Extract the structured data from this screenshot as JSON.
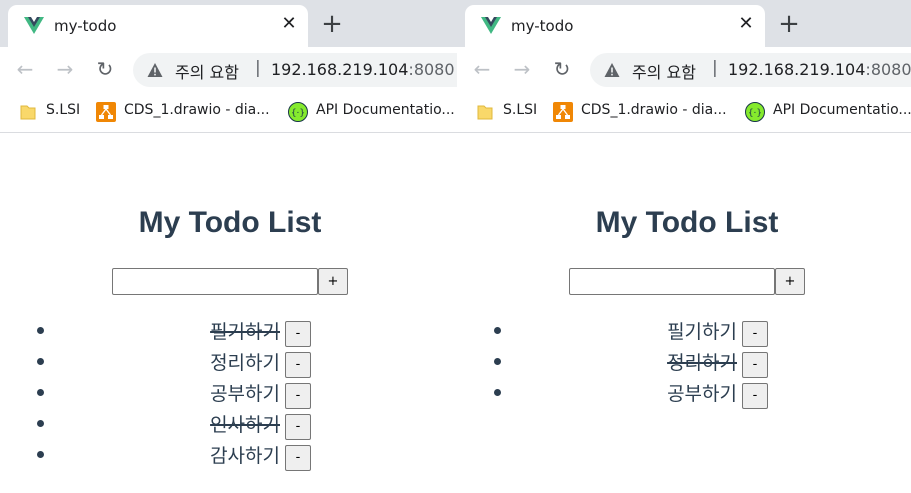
{
  "browser_left": {
    "tab_title": "my-todo",
    "omnibox": {
      "warning": "주의 요함",
      "separator": "|",
      "host": "192.168.219.104",
      "port": ":8080"
    },
    "bookmarks": [
      {
        "label": "S.LSI",
        "icon": "folder-icon"
      },
      {
        "label": "CDS_1.drawio - dia...",
        "icon": "drawio-icon"
      },
      {
        "label": "API Documentatio...",
        "icon": "swagger-icon"
      }
    ],
    "page": {
      "title": "My Todo List",
      "add_label": "+",
      "input_value": "",
      "items": [
        {
          "text": "필기하기",
          "done": true,
          "delete_label": "-"
        },
        {
          "text": "정리하기",
          "done": false,
          "delete_label": "-"
        },
        {
          "text": "공부하기",
          "done": false,
          "delete_label": "-"
        },
        {
          "text": "인사하기",
          "done": true,
          "delete_label": "-"
        },
        {
          "text": "감사하기",
          "done": false,
          "delete_label": "-"
        }
      ]
    }
  },
  "browser_right": {
    "tab_title": "my-todo",
    "omnibox": {
      "warning": "주의 요함",
      "separator": "|",
      "host": "192.168.219.104",
      "port": ":8080"
    },
    "bookmarks": [
      {
        "label": "S.LSI",
        "icon": "folder-icon"
      },
      {
        "label": "CDS_1.drawio - dia...",
        "icon": "drawio-icon"
      },
      {
        "label": "API Documentatio...",
        "icon": "swagger-icon"
      }
    ],
    "page": {
      "title": "My Todo List",
      "add_label": "+",
      "input_value": "",
      "items": [
        {
          "text": "필기하기",
          "done": false,
          "delete_label": "-"
        },
        {
          "text": "정리하기",
          "done": true,
          "delete_label": "-"
        },
        {
          "text": "공부하기",
          "done": false,
          "delete_label": "-"
        }
      ]
    }
  },
  "colors": {
    "heading": "#2c3e50",
    "vue_green": "#41b883",
    "vue_dark": "#35495e",
    "drawio_orange": "#f08705",
    "swagger_green": "#85ea2d"
  }
}
